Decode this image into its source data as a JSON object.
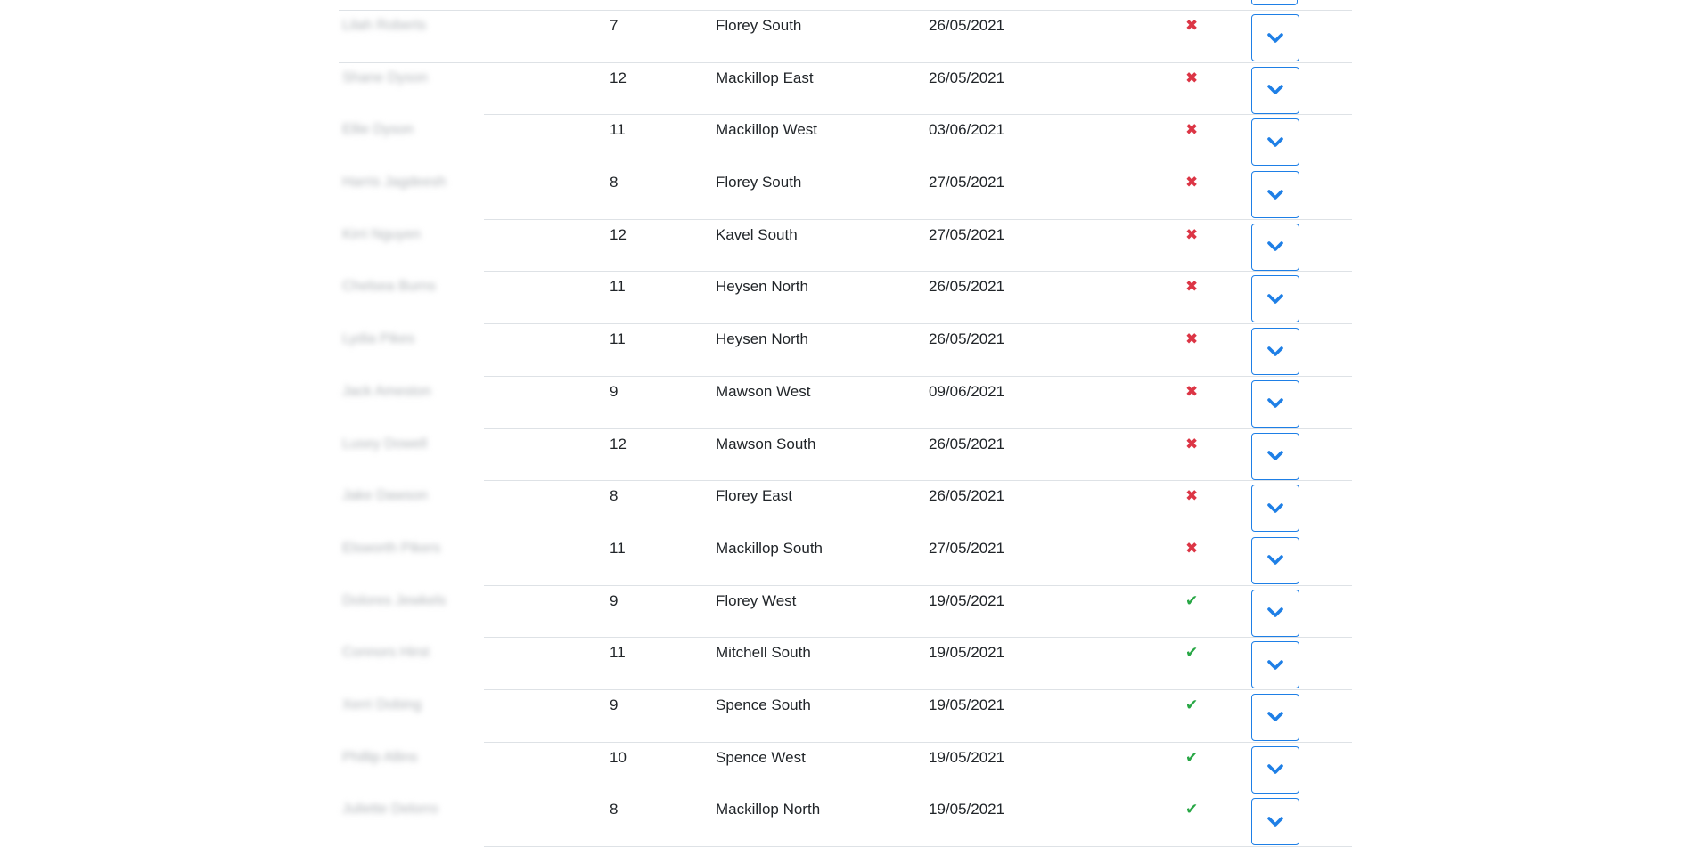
{
  "colors": {
    "accent": "#1e7fe6",
    "cross": "#dc3545",
    "tick": "#28a745",
    "divider": "#dee2e6"
  },
  "rows": [
    {
      "name": "Lilah Roberts",
      "year": "7",
      "house": "Florey South",
      "date": "26/05/2021",
      "status": "no",
      "status_glyph": "✖"
    },
    {
      "name": "Shane Dyson",
      "year": "12",
      "house": "Mackillop East",
      "date": "26/05/2021",
      "status": "no",
      "status_glyph": "✖"
    },
    {
      "name": "Ellie Dyson",
      "year": "11",
      "house": "Mackillop West",
      "date": "03/06/2021",
      "status": "no",
      "status_glyph": "✖"
    },
    {
      "name": "Harris Jagdeesh",
      "year": "8",
      "house": "Florey South",
      "date": "27/05/2021",
      "status": "no",
      "status_glyph": "✖"
    },
    {
      "name": "Kirri Nguyen",
      "year": "12",
      "house": "Kavel South",
      "date": "27/05/2021",
      "status": "no",
      "status_glyph": "✖"
    },
    {
      "name": "Chelsea Burns",
      "year": "11",
      "house": "Heysen North",
      "date": "26/05/2021",
      "status": "no",
      "status_glyph": "✖"
    },
    {
      "name": "Lydia Pikes",
      "year": "11",
      "house": "Heysen North",
      "date": "26/05/2021",
      "status": "no",
      "status_glyph": "✖"
    },
    {
      "name": "Jack Ameston",
      "year": "9",
      "house": "Mawson West",
      "date": "09/06/2021",
      "status": "no",
      "status_glyph": "✖"
    },
    {
      "name": "Lusey Dowell",
      "year": "12",
      "house": "Mawson South",
      "date": "26/05/2021",
      "status": "no",
      "status_glyph": "✖"
    },
    {
      "name": "Jake Dawson",
      "year": "8",
      "house": "Florey East",
      "date": "26/05/2021",
      "status": "no",
      "status_glyph": "✖"
    },
    {
      "name": "Elsworth Pikers",
      "year": "11",
      "house": "Mackillop South",
      "date": "27/05/2021",
      "status": "no",
      "status_glyph": "✖"
    },
    {
      "name": "Dolores Jewkels",
      "year": "9",
      "house": "Florey West",
      "date": "19/05/2021",
      "status": "yes",
      "status_glyph": "✔"
    },
    {
      "name": "Connors Hirst",
      "year": "11",
      "house": "Mitchell South",
      "date": "19/05/2021",
      "status": "yes",
      "status_glyph": "✔"
    },
    {
      "name": "Xerri Dobing",
      "year": "9",
      "house": "Spence South",
      "date": "19/05/2021",
      "status": "yes",
      "status_glyph": "✔"
    },
    {
      "name": "Phillip Allins",
      "year": "10",
      "house": "Spence West",
      "date": "19/05/2021",
      "status": "yes",
      "status_glyph": "✔"
    },
    {
      "name": "Juliette Delorro",
      "year": "8",
      "house": "Mackillop North",
      "date": "19/05/2021",
      "status": "yes",
      "status_glyph": "✔"
    }
  ],
  "icons": {
    "expand": "chevron-down-icon",
    "status_no": "cross-icon",
    "status_yes": "check-icon"
  }
}
